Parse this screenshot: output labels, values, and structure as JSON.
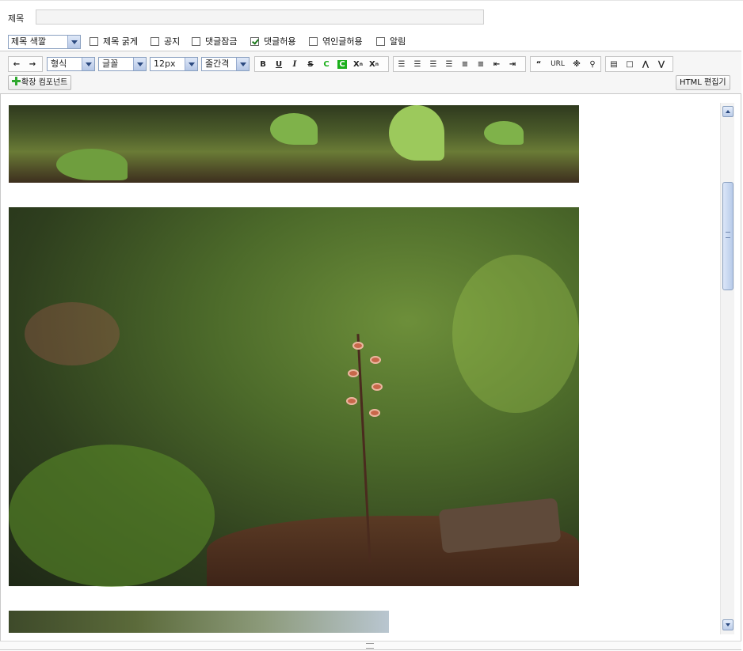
{
  "title_row": {
    "label": "제목",
    "value": ""
  },
  "options": {
    "title_color_select": "제목 색깔",
    "checkboxes": [
      {
        "label": "제목 굵게",
        "checked": false
      },
      {
        "label": "공지",
        "checked": false
      },
      {
        "label": "댓글잠금",
        "checked": false
      },
      {
        "label": "댓글허용",
        "checked": true
      },
      {
        "label": "엮인글허용",
        "checked": false
      },
      {
        "label": "알림",
        "checked": false
      }
    ]
  },
  "toolbar": {
    "format_select": "형식",
    "font_select": "글꼴",
    "size_select": "12px",
    "line_spacing_select": "줄간격",
    "bold": "B",
    "underline": "U",
    "italic": "I",
    "strike": "S",
    "font_color": "C",
    "bg_color": "C",
    "superscript": "X",
    "subscript": "X",
    "quote": "“",
    "url": "URL",
    "special_char": "※",
    "extend_component": "확장 컴포넌트",
    "html_editor": "HTML 편집기"
  },
  "colors": {
    "accent": "#8aa0c0",
    "check": "#1c7a1c",
    "plus": "#2fa82f",
    "font_color_icon": "#1cb01c"
  }
}
